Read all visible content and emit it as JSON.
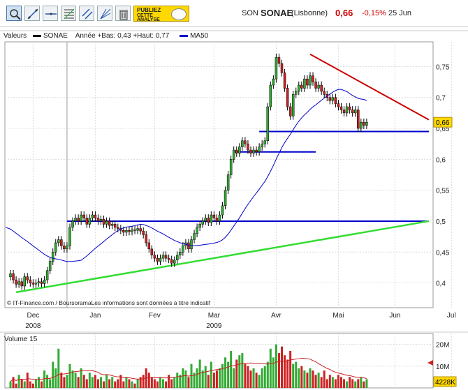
{
  "toolbar": {
    "buttons": [
      {
        "name": "zoom-tool-button",
        "icon": "magnifier-icon",
        "left": 9,
        "active": true
      },
      {
        "name": "draw-trendline-button",
        "icon": "trendline-icon",
        "left": 35
      },
      {
        "name": "draw-horizontal-line-button",
        "icon": "horizontal-line-icon",
        "left": 61
      },
      {
        "name": "fibonacci-button",
        "icon": "fibonacci-icon",
        "left": 87
      },
      {
        "name": "parallel-lines-button",
        "icon": "parallel-lines-icon",
        "left": 113
      },
      {
        "name": "fan-lines-button",
        "icon": "fan-lines-icon",
        "left": 139
      },
      {
        "name": "delete-drawings-button",
        "icon": "trash-icon",
        "left": 165
      }
    ],
    "ad": {
      "line1": "PUBLIEZ",
      "line2": "CETTE",
      "line3": "ANALYSE",
      "icon": "eye-icon"
    }
  },
  "quote": {
    "ticker": "SON",
    "name": "SONAE",
    "exchange": "(Lisbonne)",
    "price": "0,66",
    "variation": "-0,15%",
    "date": "25 Jun"
  },
  "legend": {
    "valeurs": "Valeurs",
    "series_name": "SONAE",
    "range_text": "Année +Bas: 0,43 +Haut: 0,77",
    "ma_name": "MA50",
    "series_color": "#000000",
    "ma_color": "#0000cc"
  },
  "footer": {
    "credit": "© IT-Finance.com / BoursoramaLes informations sont données à titre indicatif"
  },
  "volume": {
    "label": "Volume 15",
    "ticks": [
      "20M",
      "10M"
    ],
    "last_value": "4228K"
  },
  "chart_data": [
    {
      "type": "candlestick",
      "title": "SONAE",
      "ylim": [
        0.36,
        0.79
      ],
      "yticks": [
        "0,75",
        "0,7",
        "0,65",
        "0,6",
        "0,55",
        "0,5",
        "0,45",
        "0,4"
      ],
      "ytick_values": [
        0.75,
        0.7,
        0.65,
        0.6,
        0.55,
        0.5,
        0.45,
        0.4
      ],
      "last_price_label": "0,66",
      "last_price": 0.66,
      "xticks": [
        "Dec",
        "Jan",
        "Fev",
        "Mar",
        "Avr",
        "Mai",
        "Jun",
        "Jul"
      ],
      "year_labels": [
        {
          "text": "2008",
          "month": "Dec"
        },
        {
          "text": "2009",
          "month": "Mar"
        }
      ],
      "close": [
        0.415,
        0.405,
        0.398,
        0.402,
        0.395,
        0.41,
        0.405,
        0.4,
        0.398,
        0.4,
        0.402,
        0.399,
        0.405,
        0.42,
        0.435,
        0.45,
        0.465,
        0.47,
        0.46,
        0.455,
        0.46,
        0.49,
        0.5,
        0.505,
        0.5,
        0.51,
        0.505,
        0.495,
        0.505,
        0.51,
        0.505,
        0.5,
        0.503,
        0.495,
        0.5,
        0.493,
        0.495,
        0.49,
        0.488,
        0.485,
        0.482,
        0.485,
        0.483,
        0.486,
        0.485,
        0.488,
        0.484,
        0.478,
        0.465,
        0.455,
        0.445,
        0.44,
        0.435,
        0.44,
        0.445,
        0.44,
        0.438,
        0.432,
        0.437,
        0.445,
        0.45,
        0.46,
        0.465,
        0.455,
        0.47,
        0.48,
        0.49,
        0.495,
        0.5,
        0.505,
        0.498,
        0.51,
        0.505,
        0.5,
        0.51,
        0.525,
        0.55,
        0.575,
        0.6,
        0.615,
        0.61,
        0.62,
        0.63,
        0.625,
        0.615,
        0.61,
        0.615,
        0.612,
        0.62,
        0.625,
        0.63,
        0.685,
        0.72,
        0.73,
        0.765,
        0.755,
        0.74,
        0.715,
        0.685,
        0.67,
        0.705,
        0.71,
        0.72,
        0.715,
        0.73,
        0.72,
        0.735,
        0.725,
        0.715,
        0.72,
        0.71,
        0.705,
        0.7,
        0.695,
        0.7,
        0.69,
        0.685,
        0.68,
        0.675,
        0.685,
        0.68,
        0.675,
        0.68,
        0.65,
        0.66,
        0.655,
        0.66
      ],
      "trendlines": [
        {
          "name": "resistance",
          "color": "#cc0000",
          "from": [
            0.77,
            106
          ],
          "to": [
            0.664,
            148
          ]
        },
        {
          "name": "support-high",
          "color": "#0000cc",
          "from": [
            0.645,
            88
          ],
          "to": [
            0.645,
            148
          ]
        },
        {
          "name": "support-mid",
          "color": "#0000cc",
          "from": [
            0.612,
            79
          ],
          "to": [
            0.612,
            108
          ]
        },
        {
          "name": "support-low",
          "color": "#0000cc",
          "from": [
            0.5,
            20
          ],
          "to": [
            0.5,
            148
          ]
        },
        {
          "name": "uptrend",
          "color": "#33dd33",
          "from": [
            0.385,
            2
          ],
          "to": [
            0.5,
            148
          ]
        }
      ]
    },
    {
      "type": "bar",
      "title": "Volume 15",
      "ylim": [
        0,
        25000000
      ],
      "yticks": [
        "20M",
        "10M"
      ],
      "ytick_values": [
        20000000,
        10000000
      ],
      "last_value_label": "4228K",
      "values": [
        3,
        5,
        2,
        6,
        4,
        3,
        7,
        3,
        2,
        4,
        5,
        3,
        8,
        6,
        4,
        12,
        9,
        18,
        7,
        5,
        6,
        11,
        8,
        7,
        5,
        9,
        6,
        4,
        7,
        5,
        6,
        4,
        5,
        3,
        6,
        4,
        5,
        3,
        4,
        6,
        3,
        5,
        4,
        3,
        2,
        4,
        5,
        6,
        9,
        7,
        5,
        4,
        3,
        5,
        4,
        3,
        6,
        4,
        5,
        7,
        6,
        9,
        8,
        5,
        11,
        7,
        9,
        13,
        8,
        10,
        6,
        12,
        7,
        8,
        9,
        11,
        14,
        12,
        17,
        9,
        13,
        15,
        16,
        11,
        10,
        8,
        9,
        7,
        6,
        9,
        10,
        12,
        18,
        14,
        20,
        16,
        19,
        15,
        13,
        17,
        11,
        12,
        9,
        10,
        8,
        7,
        9,
        8,
        6,
        7,
        5,
        8,
        4,
        6,
        5,
        4,
        6,
        5,
        4,
        3,
        5,
        4,
        3,
        4,
        5,
        3,
        4
      ]
    }
  ]
}
